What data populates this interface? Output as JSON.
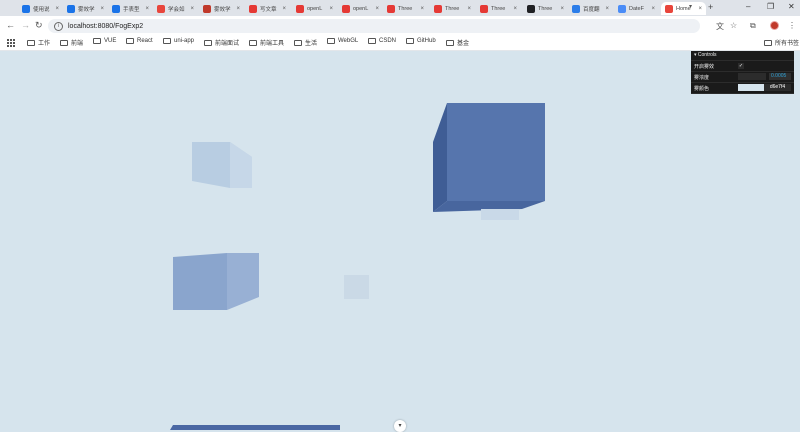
{
  "browser": {
    "tabs": [
      {
        "title": "使用说",
        "color": "#1a73e8"
      },
      {
        "title": "雾效学",
        "color": "#1a73e8"
      },
      {
        "title": "手表型",
        "color": "#1a73e8"
      },
      {
        "title": "学会如",
        "color": "#e8453c"
      },
      {
        "title": "雾效学",
        "color": "#c0392b"
      },
      {
        "title": "写文章",
        "color": "#e53935"
      },
      {
        "title": "openL",
        "color": "#e53935"
      },
      {
        "title": "openL",
        "color": "#e53935"
      },
      {
        "title": "Three",
        "color": "#e53935"
      },
      {
        "title": "Three",
        "color": "#e53935"
      },
      {
        "title": "Three",
        "color": "#e53935"
      },
      {
        "title": "Three",
        "color": "#202124"
      },
      {
        "title": "百度翻",
        "color": "#2b7de9"
      },
      {
        "title": "DateF",
        "color": "#4a8cf7"
      },
      {
        "title": "Home",
        "color": "#e8453c",
        "active": true
      }
    ],
    "url": "localhost:8080/FogExp2",
    "bookmarks": [
      "工作",
      "前端",
      "VUE",
      "React",
      "uni-app",
      "前端面试",
      "前端工具",
      "生活",
      "WebGL",
      "CSDN",
      "GitHub",
      "基金"
    ],
    "all_bookmarks": "所有书签"
  },
  "controls": {
    "title": "Controls",
    "rows": [
      {
        "label": "开启雾效",
        "type": "checkbox",
        "checked": true
      },
      {
        "label": "雾浓度",
        "type": "slider",
        "value": "0.0005"
      },
      {
        "label": "雾颜色",
        "type": "color",
        "value": "d6e7f4"
      }
    ]
  },
  "colors": {
    "scene_bg": "#d6e4ed",
    "cube_blue": "#5675ad",
    "accent": "#2fa1d6"
  }
}
